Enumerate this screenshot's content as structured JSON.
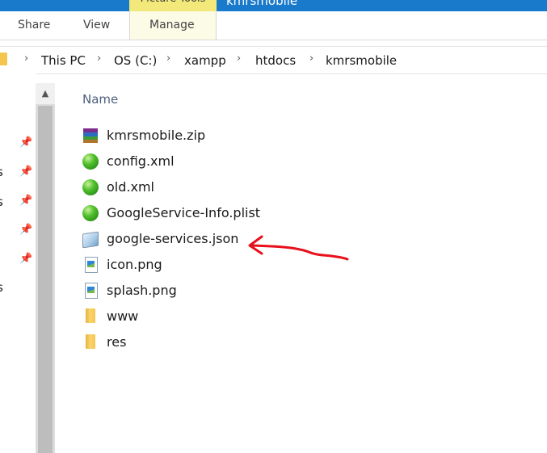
{
  "titlebar": {
    "context_tab": "Picture Tools",
    "window_title": "kmrsmobile"
  },
  "ribbon": {
    "tabs": [
      {
        "label": "Share"
      },
      {
        "label": "View"
      },
      {
        "label": "Manage"
      }
    ]
  },
  "address": {
    "crumbs": [
      "This PC",
      "OS (C:)",
      "xampp",
      "htdocs",
      "kmrsmobile"
    ],
    "separator": "›"
  },
  "filelist": {
    "column_name": "Name",
    "files": [
      {
        "name": "kmrsmobile.zip",
        "icon": "winrar-archive-icon"
      },
      {
        "name": "config.xml",
        "icon": "green-globe-xml-icon"
      },
      {
        "name": "old.xml",
        "icon": "green-globe-xml-icon"
      },
      {
        "name": "GoogleService-Info.plist",
        "icon": "green-globe-plist-icon"
      },
      {
        "name": "google-services.json",
        "icon": "notepad-json-icon"
      },
      {
        "name": "icon.png",
        "icon": "image-file-icon"
      },
      {
        "name": "splash.png",
        "icon": "image-file-icon"
      },
      {
        "name": "www",
        "icon": "folder-icon"
      },
      {
        "name": "res",
        "icon": "folder-icon"
      }
    ]
  },
  "navpane": {
    "pin_glyph": "📌",
    "clipped_labels": [
      "s",
      "s",
      "s"
    ]
  },
  "annotation": {
    "color": "#e8101a",
    "points_to": "google-services.json"
  },
  "colors": {
    "titlebar": "#1979ca",
    "context_tab": "#f2e97a",
    "manage_tab_bg": "#fcfbe6",
    "column_header": "#4c607a"
  }
}
